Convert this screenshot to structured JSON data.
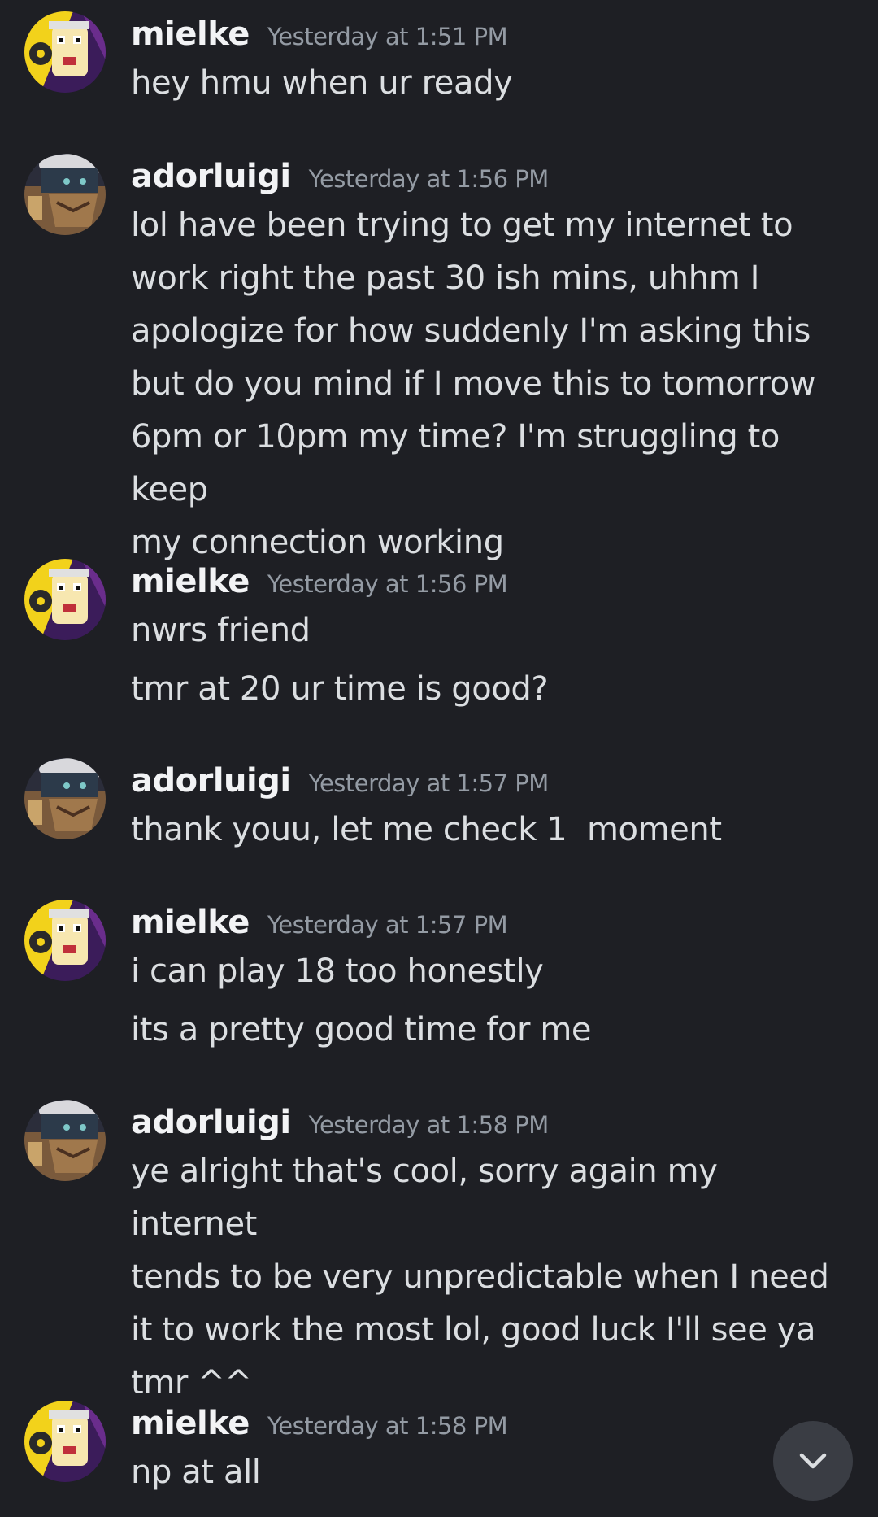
{
  "messages": [
    {
      "author": "mielke",
      "timestamp": "Yesterday at 1:51 PM",
      "lines": [
        "hey hmu when ur ready"
      ]
    },
    {
      "author": "adorluigi",
      "timestamp": "Yesterday at 1:56 PM",
      "lines": [
        "lol have been trying to get my internet to",
        "work right the past 30 ish mins, uhhm I",
        "apologize for how suddenly I'm asking this",
        "but do you mind if I move this to tomorrow",
        "6pm or 10pm my time? I'm struggling to keep",
        "my connection working"
      ]
    },
    {
      "author": "mielke",
      "timestamp": "Yesterday at 1:56 PM",
      "lines": [
        "nwrs friend",
        "tmr at 20 ur time is good?"
      ]
    },
    {
      "author": "adorluigi",
      "timestamp": "Yesterday at 1:57 PM",
      "lines": [
        "thank youu, let me check 1  moment"
      ]
    },
    {
      "author": "mielke",
      "timestamp": "Yesterday at 1:57 PM",
      "lines": [
        "i can play 18 too honestly",
        "its a pretty good time for me"
      ]
    },
    {
      "author": "adorluigi",
      "timestamp": "Yesterday at 1:58 PM",
      "lines": [
        "ye alright that's cool, sorry again my internet",
        "tends to be very unpredictable when I need",
        "it to work the most lol, good luck I'll see ya",
        "tmr ^^"
      ]
    },
    {
      "author": "mielke",
      "timestamp": "Yesterday at 1:58 PM",
      "lines": [
        "np at all"
      ]
    }
  ],
  "scroll_button": {
    "icon": "chevron-down-icon"
  },
  "colors": {
    "background": "#1e1f24",
    "author": "#f2f3f5",
    "timestamp": "#949ba4",
    "message": "#dbdee1",
    "scroll_button": "#3a3d44"
  }
}
